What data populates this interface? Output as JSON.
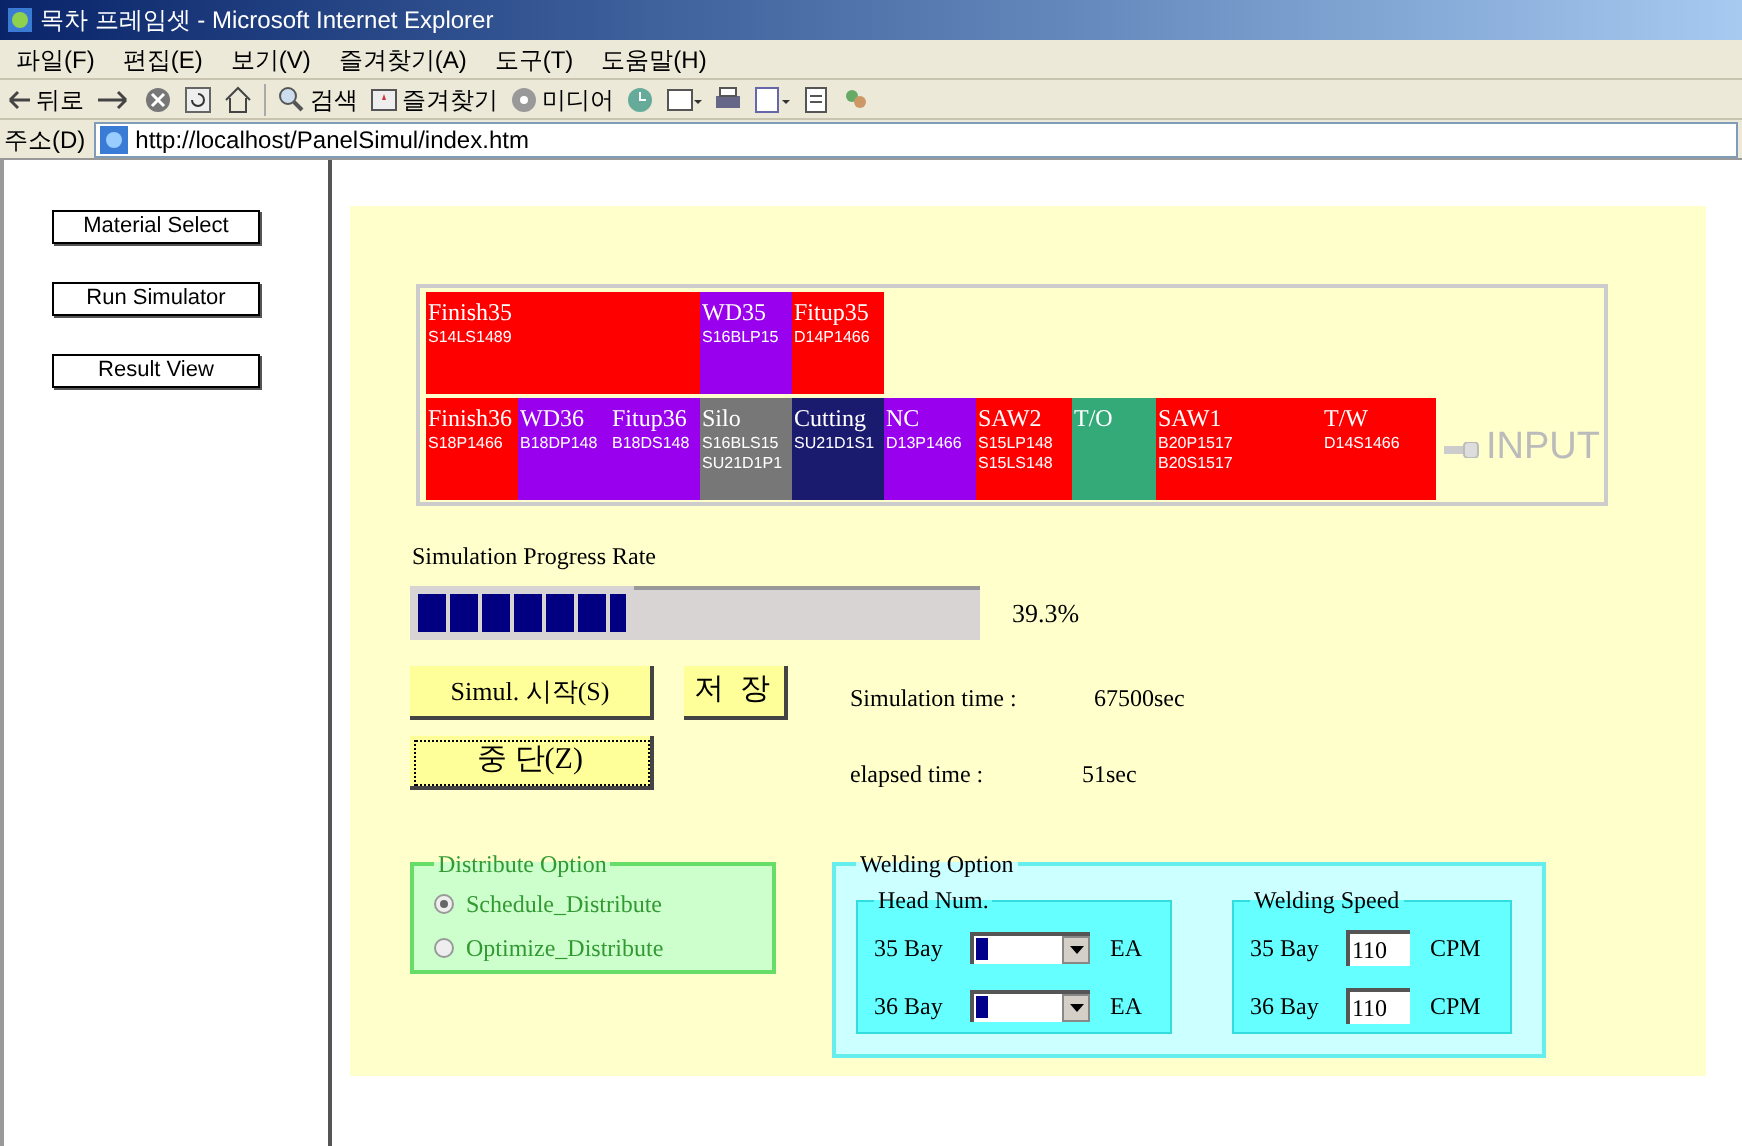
{
  "window": {
    "title": "목차 프레임셋 - Microsoft Internet Explorer"
  },
  "menu": [
    "파일(F)",
    "편집(E)",
    "보기(V)",
    "즐겨찾기(A)",
    "도구(T)",
    "도움말(H)"
  ],
  "toolbar": {
    "back": "뒤로",
    "search": "검색",
    "favorites": "즐겨찾기",
    "media": "미디어"
  },
  "address": {
    "label": "주소(D)",
    "url": "http://localhost/PanelSimul/index.htm"
  },
  "sidebar": {
    "buttons": [
      "Material Select",
      "Run Simulator",
      "Result View"
    ]
  },
  "process_rows": [
    {
      "cells": [
        {
          "name": "Finish35",
          "codes": [
            "S14LS1489"
          ],
          "color": "#ff0000"
        },
        {
          "name": "WD35",
          "codes": [
            "S16BLP15"
          ],
          "color": "#9900ee"
        },
        {
          "name": "Fitup35",
          "codes": [
            "D14P1466"
          ],
          "color": "#ff0000"
        }
      ]
    },
    {
      "cells": [
        {
          "name": "Finish36",
          "codes": [
            "S18P1466"
          ],
          "color": "#ff0000"
        },
        {
          "name": "WD36",
          "codes": [
            "B18DP148"
          ],
          "color": "#9900ee"
        },
        {
          "name": "Fitup36",
          "codes": [
            "B18DS148"
          ],
          "color": "#9900ee"
        },
        {
          "name": "Silo",
          "codes": [
            "S16BLS15",
            "SU21D1P1"
          ],
          "color": "#777777"
        },
        {
          "name": "Cutting",
          "codes": [
            "SU21D1S1"
          ],
          "color": "#1a1a6e"
        },
        {
          "name": "NC",
          "codes": [
            "D13P1466"
          ],
          "color": "#9900ee"
        },
        {
          "name": "SAW2",
          "codes": [
            "S15LP148",
            "S15LS148"
          ],
          "color": "#ff0000"
        },
        {
          "name": "T/O",
          "color": "#33aa77"
        },
        {
          "name": "SAW1",
          "codes": [
            "B20P1517",
            "B20S1517"
          ],
          "color": "#ff0000"
        },
        {
          "name": "T/W",
          "codes": [
            "D14S1466"
          ],
          "color": "#ff0000"
        }
      ]
    }
  ],
  "input_label": "INPUT",
  "progress": {
    "label": "Simulation Progress Rate",
    "level": 0.393,
    "reading": "39.3%"
  },
  "buttons": {
    "start": "Simul. 시작(S)",
    "save": "저 장",
    "stop": "중 단(Z)"
  },
  "times": [
    {
      "label": "Simulation time :",
      "value": "67500sec"
    },
    {
      "label": "elapsed time :",
      "value": "51sec"
    }
  ],
  "distribute_option": {
    "legend": "Distribute Option",
    "options": [
      {
        "label": "Schedule_Distribute",
        "selected": true
      },
      {
        "label": "Optimize_Distribute",
        "selected": false
      }
    ]
  },
  "welding_option": {
    "legend": "Welding Option",
    "head_num": {
      "legend": "Head Num.",
      "rows": [
        {
          "bay": "35 Bay",
          "unit": "EA"
        },
        {
          "bay": "36 Bay",
          "unit": "EA"
        }
      ]
    },
    "welding_speed": {
      "legend": "Welding Speed",
      "rows": [
        {
          "bay": "35 Bay",
          "value": "110",
          "unit": "CPM"
        },
        {
          "bay": "36 Bay",
          "value": "110",
          "unit": "CPM"
        }
      ]
    }
  }
}
